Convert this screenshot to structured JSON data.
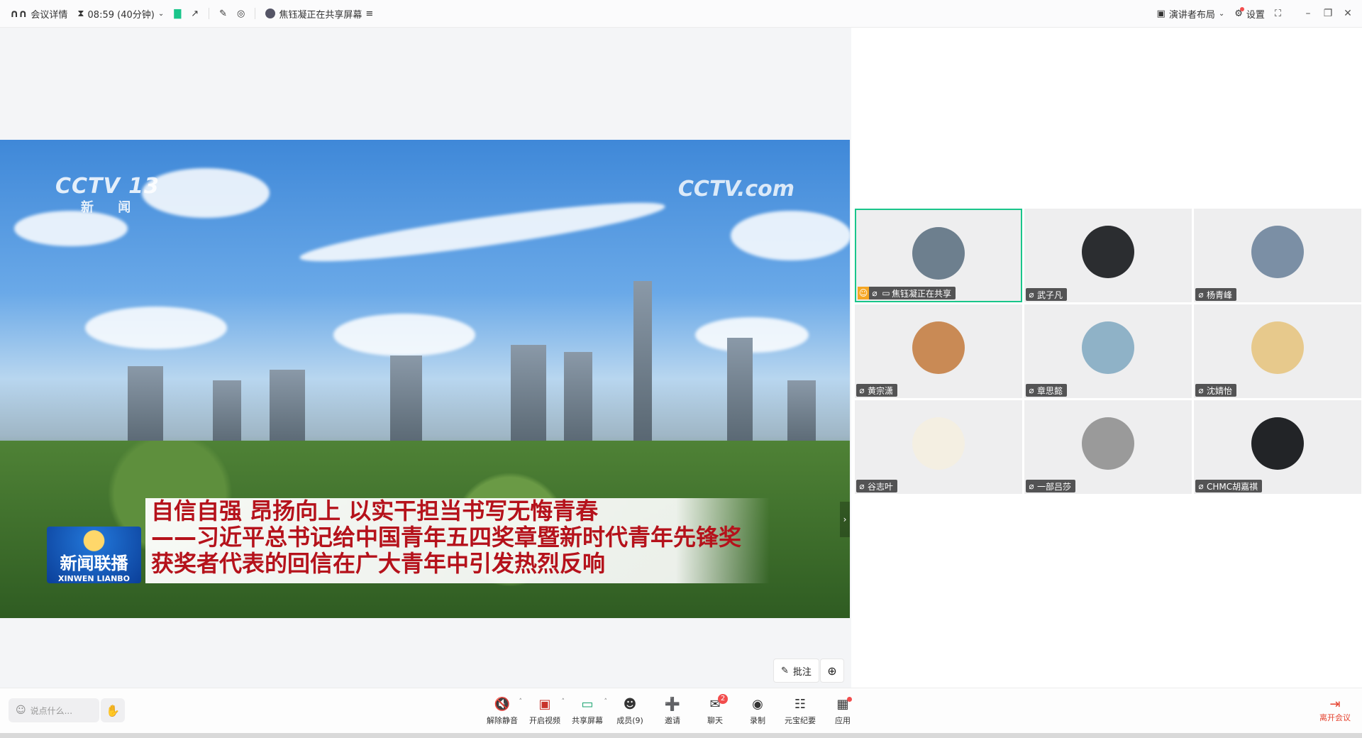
{
  "topbar": {
    "meeting_details": "会议详情",
    "timer": "08:59 (40分钟)",
    "sharing_status": "焦钰凝正在共享屏幕",
    "layout": "演讲者布局",
    "settings": "设置"
  },
  "shared_screen": {
    "channel_logo": "CCTV 13",
    "channel_sub": "新 闻",
    "site_logo": "CCTV.com",
    "headline_lines": [
      "自信自强 昂扬向上 以实干担当书写无悔青春",
      "——习近平总书记给中国青年五四奖章暨新时代青年先锋奖",
      "获奖者代表的回信在广大青年中引发热烈反响"
    ],
    "program_logo": "新闻联播",
    "program_logo_pinyin": "XINWEN LIANBO"
  },
  "annotate_button": "批注",
  "participants": [
    {
      "name": "焦钰凝正在共享",
      "active": true,
      "avatar": "#6d7f8e"
    },
    {
      "name": "武子凡",
      "active": false,
      "avatar": "#2b2d30"
    },
    {
      "name": "杨青峰",
      "active": false,
      "avatar": "#7b8fa5"
    },
    {
      "name": "黄宗潇",
      "active": false,
      "avatar": "#c98a55"
    },
    {
      "name": "章思懿",
      "active": false,
      "avatar": "#8fb2c7"
    },
    {
      "name": "沈婧怡",
      "active": false,
      "avatar": "#e7c98c"
    },
    {
      "name": "谷志叶",
      "active": false,
      "avatar": "#f4efe2"
    },
    {
      "name": "一部吕莎",
      "active": false,
      "avatar": "#9a9a9a"
    },
    {
      "name": "CHMC胡嘉祺",
      "active": false,
      "avatar": "#222427"
    }
  ],
  "bottombar": {
    "chat_placeholder": "说点什么...",
    "tools": [
      {
        "label": "解除静音",
        "icon": "mic-muted-icon",
        "caret": true
      },
      {
        "label": "开启视频",
        "icon": "video-off-icon",
        "caret": true
      },
      {
        "label": "共享屏幕",
        "icon": "share-screen-icon",
        "caret": true
      },
      {
        "label": "成员(9)",
        "icon": "members-icon",
        "caret": false
      },
      {
        "label": "邀请",
        "icon": "invite-icon",
        "caret": false
      },
      {
        "label": "聊天",
        "icon": "chat-icon",
        "caret": false,
        "badge": "2"
      },
      {
        "label": "录制",
        "icon": "record-icon",
        "caret": false
      },
      {
        "label": "元宝纪要",
        "icon": "minutes-icon",
        "caret": false
      },
      {
        "label": "应用",
        "icon": "apps-icon",
        "caret": false,
        "dot": true
      }
    ],
    "leave_label": "离开会议"
  },
  "colors": {
    "active_border": "#19c58a",
    "leave": "#e5412d",
    "badge": "#f24d4d"
  }
}
